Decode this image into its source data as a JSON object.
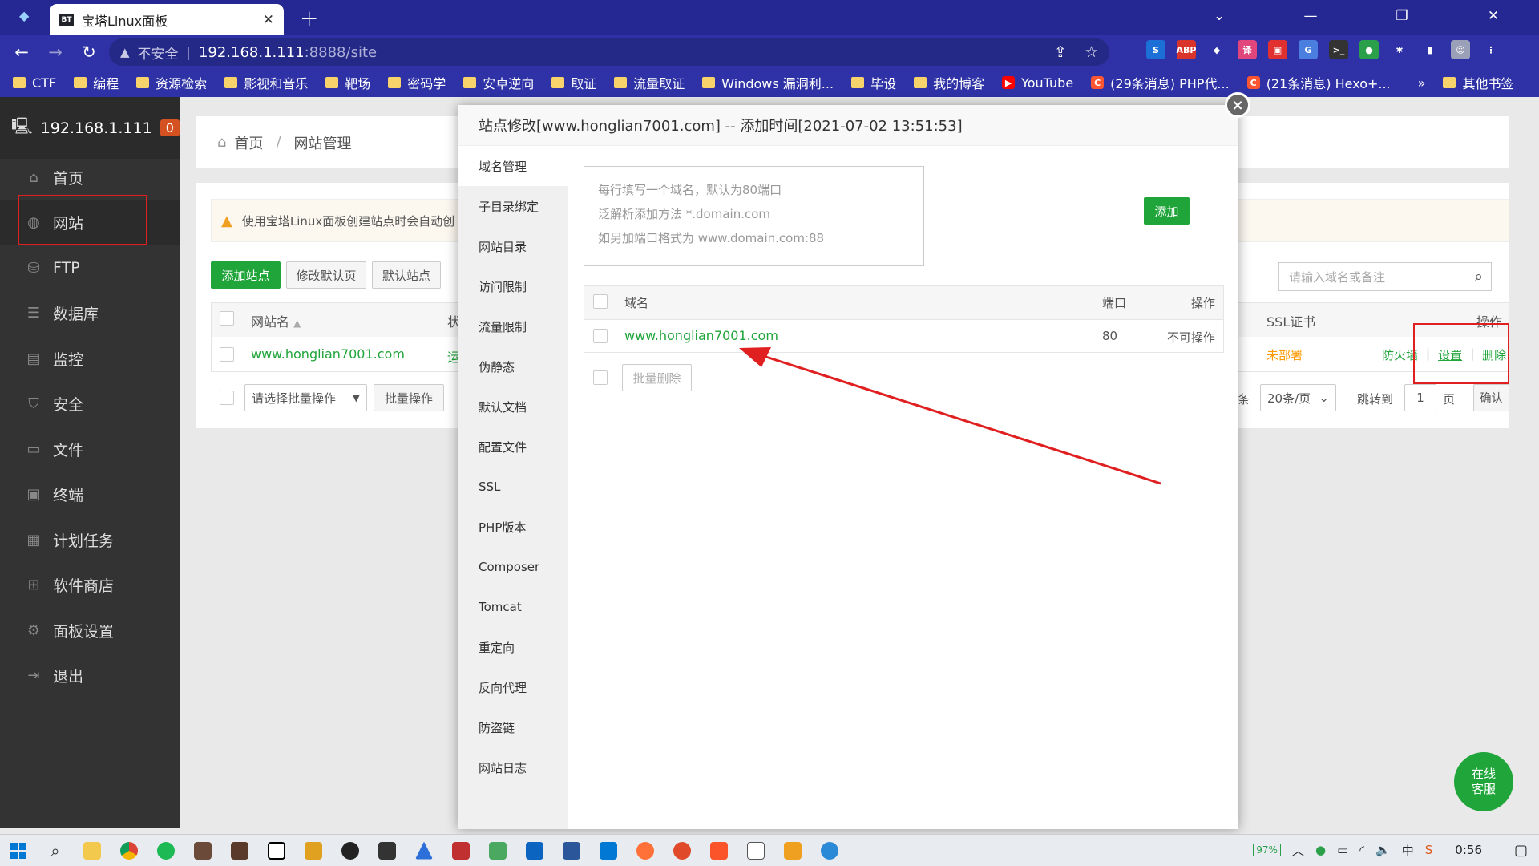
{
  "browser": {
    "tab_title": "宝塔Linux面板",
    "tab_favicon": "BT",
    "new_tab": "+",
    "security": "不安全",
    "url_host": "192.168.1.111",
    "url_rest": ":8888/site",
    "bookmarks": [
      {
        "label": "CTF",
        "type": "folder"
      },
      {
        "label": "编程",
        "type": "folder"
      },
      {
        "label": "资源检索",
        "type": "folder"
      },
      {
        "label": "影视和音乐",
        "type": "folder"
      },
      {
        "label": "靶场",
        "type": "folder"
      },
      {
        "label": "密码学",
        "type": "folder"
      },
      {
        "label": "安卓逆向",
        "type": "folder"
      },
      {
        "label": "取证",
        "type": "folder"
      },
      {
        "label": "流量取证",
        "type": "folder"
      },
      {
        "label": "Windows 漏洞利...",
        "type": "folder"
      },
      {
        "label": "毕设",
        "type": "folder"
      },
      {
        "label": "我的博客",
        "type": "folder"
      },
      {
        "label": "YouTube",
        "type": "youtube"
      },
      {
        "label": "(29条消息) PHP代...",
        "type": "csdn"
      },
      {
        "label": "(21条消息) Hexo+...",
        "type": "csdn"
      }
    ],
    "bookmarks_more": "»",
    "other_bookmarks": "其他书签",
    "extensions": [
      {
        "name": "s-icon",
        "text": "S",
        "color": "#1d6fd8"
      },
      {
        "name": "abp-icon",
        "text": "ABP",
        "color": "#d9342b"
      },
      {
        "name": "diamond-icon",
        "text": "◆",
        "color": "#2e32a6"
      },
      {
        "name": "translate-icon",
        "text": "译",
        "color": "#e0457b"
      },
      {
        "name": "red-ext-icon",
        "text": "▣",
        "color": "#e03030"
      },
      {
        "name": "gtranslate-icon",
        "text": "G",
        "color": "#4a7fe0"
      },
      {
        "name": "terminal-ext-icon",
        "text": ">_",
        "color": "#333333"
      },
      {
        "name": "globe-ext-icon",
        "text": "●",
        "color": "#2aa04a"
      },
      {
        "name": "puzzle-icon",
        "text": "✱",
        "color": "#2e32a6"
      },
      {
        "name": "sidepanel-icon",
        "text": "▮",
        "color": "#2e32a6"
      },
      {
        "name": "profile-icon",
        "text": "☺",
        "color": "#9aa0b8"
      },
      {
        "name": "menu-icon",
        "text": "⋮",
        "color": "#2e32a6"
      }
    ]
  },
  "sidebar": {
    "ip": "192.168.1.111",
    "count": "0",
    "items": [
      {
        "label": "首页",
        "icon": "home-icon",
        "glyph": "⌂"
      },
      {
        "label": "网站",
        "icon": "globe-icon",
        "glyph": "◍"
      },
      {
        "label": "FTP",
        "icon": "ftp-icon",
        "glyph": "⛁"
      },
      {
        "label": "数据库",
        "icon": "database-icon",
        "glyph": "☰"
      },
      {
        "label": "监控",
        "icon": "monitor-icon",
        "glyph": "▤"
      },
      {
        "label": "安全",
        "icon": "shield-icon",
        "glyph": "⛉"
      },
      {
        "label": "文件",
        "icon": "folder-icon",
        "glyph": "▭"
      },
      {
        "label": "终端",
        "icon": "terminal-icon",
        "glyph": "▣"
      },
      {
        "label": "计划任务",
        "icon": "calendar-icon",
        "glyph": "▦"
      },
      {
        "label": "软件商店",
        "icon": "apps-icon",
        "glyph": "⊞"
      },
      {
        "label": "面板设置",
        "icon": "settings-icon",
        "glyph": "⚙"
      },
      {
        "label": "退出",
        "icon": "logout-icon",
        "glyph": "⇥"
      }
    ]
  },
  "breadcrumb": {
    "home": "首页",
    "sep": "/",
    "current": "网站管理"
  },
  "page": {
    "notice": "使用宝塔Linux面板创建站点时会自动创",
    "buttons": {
      "add_site": "添加站点",
      "modify_default": "修改默认页",
      "default_site": "默认站点"
    },
    "search_placeholder": "请输入域名或备注",
    "table": {
      "col_name": "网站名",
      "col_status": "状",
      "col_ssl": "SSL证书",
      "col_ops": "操作",
      "sort_icon": "▲"
    },
    "row": {
      "name": "www.honglian7001.com",
      "status": "运",
      "ssl": "未部署",
      "firewall": "防火墙",
      "set": "设置",
      "delete": "删除",
      "sep": "|"
    },
    "batch_select": "请选择批量操作",
    "batch_btn": "批量操作",
    "pagination": {
      "tiao": "条",
      "per_page": "20条/页",
      "jump": "跳转到",
      "page_num": "1",
      "page": "页",
      "confirm": "确认"
    }
  },
  "modal": {
    "title": "站点修改[www.honglian7001.com] -- 添加时间[2021-07-02 13:51:53]",
    "close": "×",
    "menu": [
      "域名管理",
      "子目录绑定",
      "网站目录",
      "访问限制",
      "流量限制",
      "伪静态",
      "默认文档",
      "配置文件",
      "SSL",
      "PHP版本",
      "Composer",
      "Tomcat",
      "重定向",
      "反向代理",
      "防盗链",
      "网站日志"
    ],
    "placeholder_lines": [
      "每行填写一个域名，默认为80端口",
      "泛解析添加方法 *.domain.com",
      "如另加端口格式为 www.domain.com:88"
    ],
    "add": "添加",
    "table": {
      "col_domain": "域名",
      "col_port": "端口",
      "col_ops": "操作"
    },
    "rows": [
      {
        "domain": "www.honglian7001.com",
        "port": "80",
        "ops": "不可操作"
      }
    ],
    "batch_delete": "批量删除"
  },
  "chat": {
    "line1": "在线",
    "line2": "客服"
  },
  "taskbar": {
    "battery": "97%",
    "time": "0:56",
    "ime": "中"
  },
  "colors": {
    "accent_green": "#20a53a",
    "chrome_blue": "#2e32a6",
    "annotation_red": "#e02020",
    "sidebar_bg": "#333333",
    "ssl_orange": "#ff9900"
  }
}
